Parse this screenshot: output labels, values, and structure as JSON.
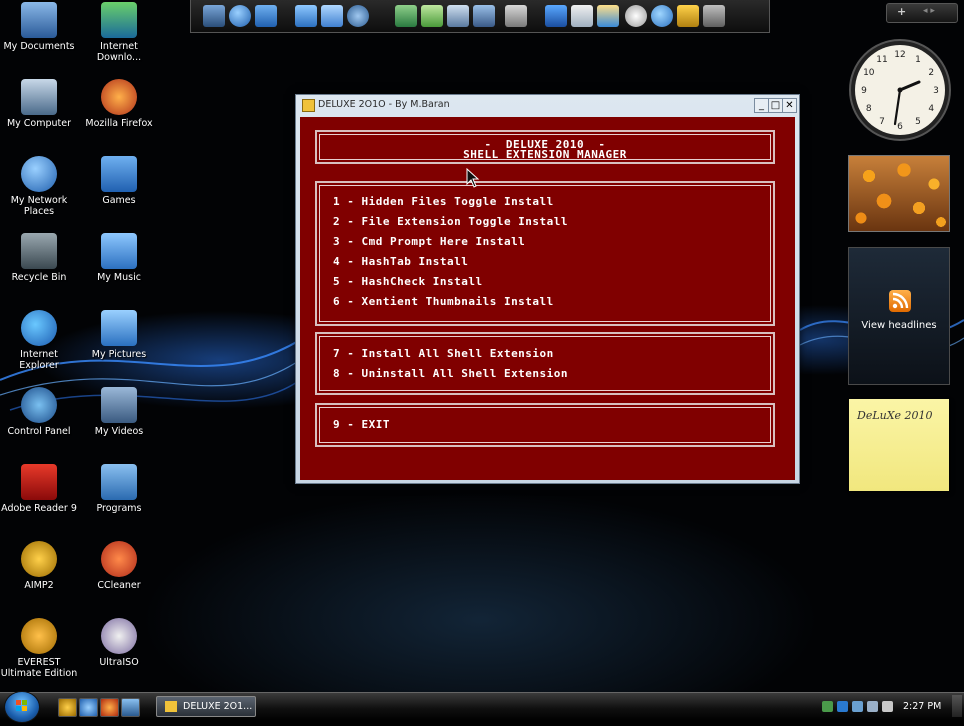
{
  "desktop_icons": [
    {
      "label": "My Documents",
      "icon": "folder-documents-icon"
    },
    {
      "label": "Internet Downlo...",
      "icon": "internet-download-manager-icon"
    },
    {
      "label": "My Computer",
      "icon": "computer-icon"
    },
    {
      "label": "Mozilla Firefox",
      "icon": "firefox-icon"
    },
    {
      "label": "My Network Places",
      "icon": "network-globe-icon"
    },
    {
      "label": "Games",
      "icon": "games-folder-icon"
    },
    {
      "label": "Recycle Bin",
      "icon": "recycle-bin-icon"
    },
    {
      "label": "My Music",
      "icon": "music-folder-icon"
    },
    {
      "label": "Internet Explorer",
      "icon": "internet-explorer-icon"
    },
    {
      "label": "My Pictures",
      "icon": "pictures-folder-icon"
    },
    {
      "label": "Control Panel",
      "icon": "control-panel-icon"
    },
    {
      "label": "My Videos",
      "icon": "videos-folder-icon"
    },
    {
      "label": "Adobe Reader 9",
      "icon": "adobe-reader-icon"
    },
    {
      "label": "Programs",
      "icon": "programs-folder-icon"
    },
    {
      "label": "AIMP2",
      "icon": "aimp-icon"
    },
    {
      "label": "CCleaner",
      "icon": "ccleaner-icon"
    },
    {
      "label": "EVEREST Ultimate Edition",
      "icon": "everest-icon"
    },
    {
      "label": "UltraISO",
      "icon": "ultraiso-disc-icon"
    }
  ],
  "window": {
    "title": "DELUXE 2O1O - By M.Baran",
    "minimize": "_",
    "maximize": "□",
    "close": "✕",
    "header_line1": "-  DELUXE 2010  -",
    "header_line2": "SHELL EXTENSION MANAGER",
    "menu_group1": [
      "1 - Hidden Files Toggle Install",
      "2 - File Extension Toggle Install",
      "3 - Cmd Prompt Here Install",
      "4 - HashTab Install",
      "5 - HashCheck Install",
      "6 - Xentient Thumbnails Install"
    ],
    "menu_group2": [
      "7 - Install All Shell Extension",
      "8 - Uninstall All Shell Extension"
    ],
    "menu_group3": [
      "9 - EXIT"
    ]
  },
  "gadgets": {
    "sidebar_add": "+",
    "sidebar_nav": "◂ ▸",
    "rss_label": "View headlines",
    "note_text": "DeLuXe 2010",
    "clock_numbers": [
      "12",
      "1",
      "2",
      "3",
      "4",
      "5",
      "6",
      "7",
      "8",
      "9",
      "10",
      "11"
    ]
  },
  "taskbar": {
    "task_label": "DELUXE 2O1...",
    "time": "2:27 PM"
  },
  "colors": {
    "console_bg": "#800000",
    "console_text": "#ffffff",
    "note_yellow": "#f6ee96"
  }
}
